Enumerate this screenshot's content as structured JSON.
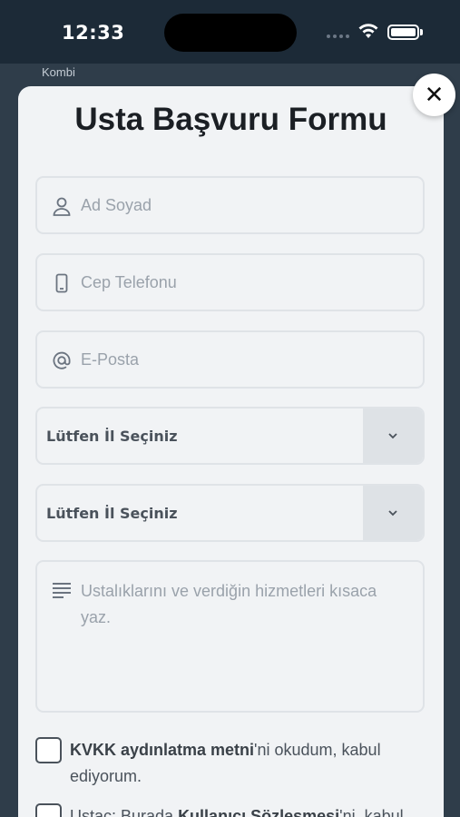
{
  "status_bar": {
    "time": "12:33"
  },
  "background_page": {
    "label": "Kombi"
  },
  "form": {
    "title": "Usta Başvuru Formu",
    "name_placeholder": "Ad Soyad",
    "phone_placeholder": "Cep Telefonu",
    "email_placeholder": "E-Posta",
    "city_select_1": "Lütfen İl Seçiniz",
    "city_select_2": "Lütfen İl Seçiniz",
    "description_placeholder": "Ustalıklarını ve verdiğin hizmetleri kısaca yaz.",
    "kvkk": {
      "link": "KVKK aydınlatma metni",
      "rest": "'ni okudum, kabul ediyorum."
    },
    "terms": {
      "prefix": "Ustaç: Burada ",
      "link": "Kullanıcı Sözleşmesi",
      "rest": "'ni, kabul"
    }
  },
  "close_icon": "close-icon",
  "colors": {
    "sheet_bg": "#f1f3f5",
    "backdrop": "#2f3d4a",
    "status_bar": "#1c2a37"
  }
}
